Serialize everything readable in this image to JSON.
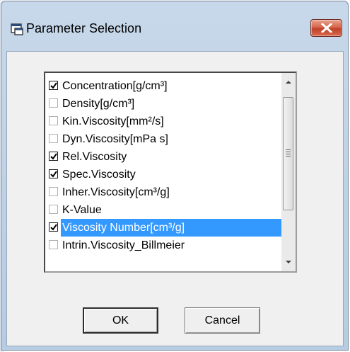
{
  "window": {
    "title": "Parameter Selection",
    "close_icon": "close-x-icon"
  },
  "parameter_list": {
    "items": [
      {
        "label": "Concentration[g/cm³]",
        "checked": true,
        "selected": false
      },
      {
        "label": "Density[g/cm³]",
        "checked": false,
        "selected": false
      },
      {
        "label": "Kin.Viscosity[mm²/s]",
        "checked": false,
        "selected": false
      },
      {
        "label": "Dyn.Viscosity[mPa s]",
        "checked": false,
        "selected": false
      },
      {
        "label": "Rel.Viscosity",
        "checked": true,
        "selected": false
      },
      {
        "label": "Spec.Viscosity",
        "checked": true,
        "selected": false
      },
      {
        "label": "Inher.Viscosity[cm³/g]",
        "checked": false,
        "selected": false
      },
      {
        "label": "K-Value",
        "checked": false,
        "selected": false
      },
      {
        "label": "Viscosity Number[cm³/g]",
        "checked": true,
        "selected": true
      },
      {
        "label": "Intrin.Viscosity_Billmeier",
        "checked": false,
        "selected": false
      }
    ],
    "selection_color": "#3399ff"
  },
  "buttons": {
    "ok_label": "OK",
    "cancel_label": "Cancel"
  }
}
